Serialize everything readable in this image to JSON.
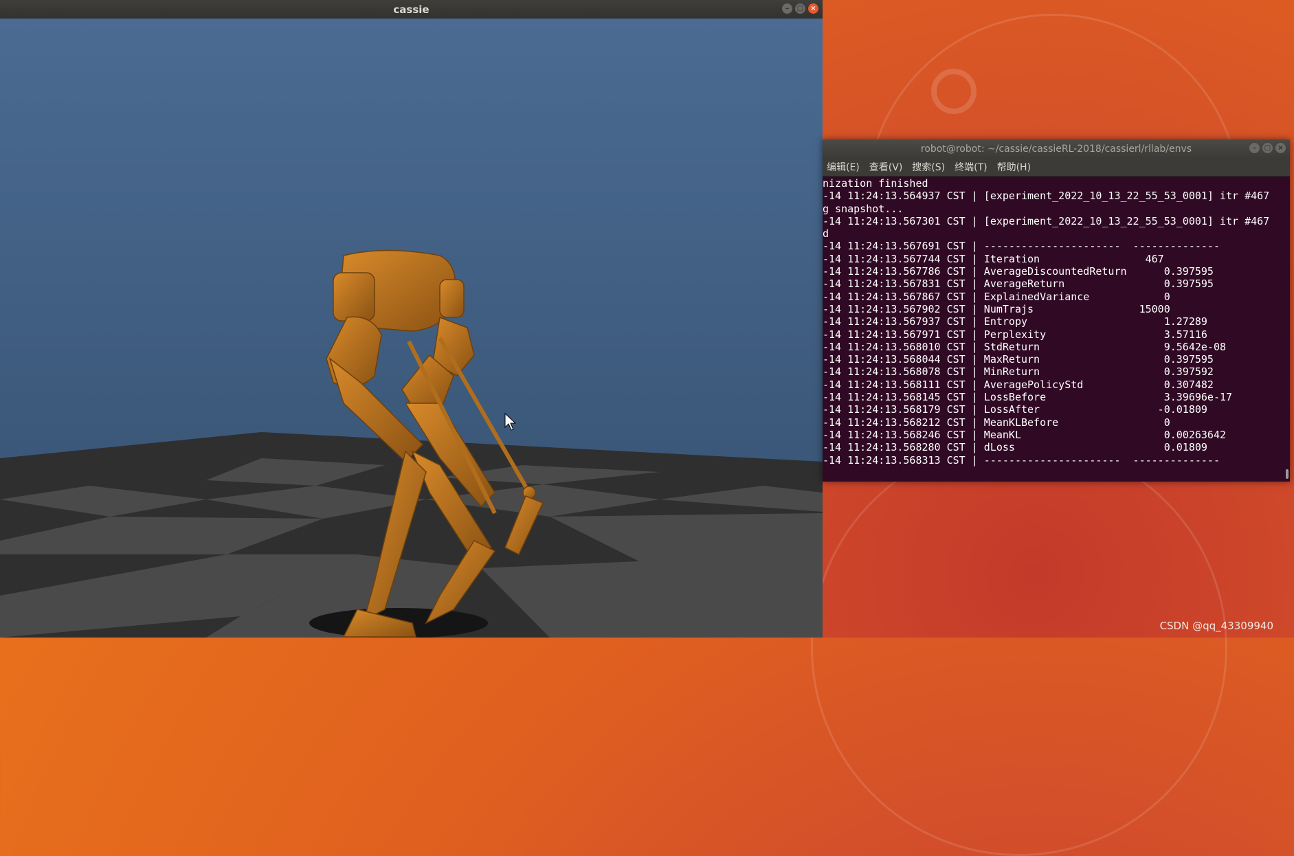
{
  "sim_window": {
    "title": "cassie"
  },
  "terminal": {
    "title": "robot@robot: ~/cassie/cassieRL-2018/cassierl/rllab/envs",
    "menu": [
      "编辑(E)",
      "查看(V)",
      "搜索(S)",
      "终端(T)",
      "帮助(H)"
    ],
    "lines": [
      "nization finished",
      "-14 11:24:13.564937 CST | [experiment_2022_10_13_22_55_53_0001] itr #467",
      "g snapshot...",
      "-14 11:24:13.567301 CST | [experiment_2022_10_13_22_55_53_0001] itr #467",
      "d",
      "-14 11:24:13.567691 CST | ----------------------  --------------",
      "-14 11:24:13.567744 CST | Iteration                 467",
      "-14 11:24:13.567786 CST | AverageDiscountedReturn      0.397595",
      "-14 11:24:13.567831 CST | AverageReturn                0.397595",
      "-14 11:24:13.567867 CST | ExplainedVariance            0",
      "-14 11:24:13.567902 CST | NumTrajs                 15000",
      "-14 11:24:13.567937 CST | Entropy                      1.27289",
      "-14 11:24:13.567971 CST | Perplexity                   3.57116",
      "-14 11:24:13.568010 CST | StdReturn                    9.5642e-08",
      "-14 11:24:13.568044 CST | MaxReturn                    0.397595",
      "-14 11:24:13.568078 CST | MinReturn                    0.397592",
      "-14 11:24:13.568111 CST | AveragePolicyStd             0.307482",
      "-14 11:24:13.568145 CST | LossBefore                   3.39696e-17",
      "-14 11:24:13.568179 CST | LossAfter                   -0.01809",
      "-14 11:24:13.568212 CST | MeanKLBefore                 0",
      "-14 11:24:13.568246 CST | MeanKL                       0.00263642",
      "-14 11:24:13.568280 CST | dLoss                        0.01809",
      "-14 11:24:13.568313 CST | ----------------------  --------------"
    ]
  },
  "watermark": "CSDN @qq_43309940",
  "colors": {
    "sky": "#4a6b93",
    "robot": "#c07a22",
    "terminal_bg": "#300a24",
    "close_button": "#e9582f"
  },
  "icons": {
    "minimize": "minimize-icon",
    "maximize": "maximize-icon",
    "close": "close-icon"
  }
}
